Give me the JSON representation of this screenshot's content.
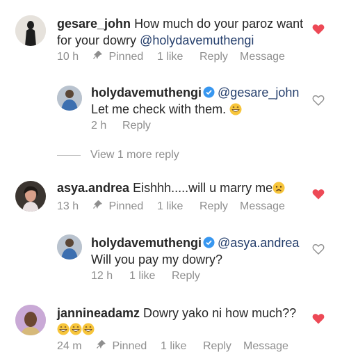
{
  "comments": [
    {
      "username": "gesare_john",
      "text_line1": "How much do your paroz want",
      "text_line2_prefix": "for your dowry",
      "mention": "@holydavemuthengi",
      "time": "10 h",
      "pinned": "Pinned",
      "likes": "1 like",
      "reply": "Reply",
      "message": "Message",
      "liked": true
    },
    {
      "username": "holydavemuthengi",
      "mention": "@gesare_john",
      "text": "Let me check with them.",
      "emoji": "grinning",
      "time": "2 h",
      "reply": "Reply",
      "liked": false
    },
    {
      "username": "asya.andrea",
      "text": "Eishhh.....will u marry me",
      "emoji": "worried",
      "time": "13 h",
      "pinned": "Pinned",
      "likes": "1 like",
      "reply": "Reply",
      "message": "Message",
      "liked": true
    },
    {
      "username": "holydavemuthengi",
      "mention": "@asya.andrea",
      "text": "Will you pay my dowry?",
      "time": "12 h",
      "likes": "1 like",
      "reply": "Reply",
      "liked": false
    },
    {
      "username": "jannineadamz",
      "text": "Dowry yako ni how much??",
      "emoji": "grinning x3",
      "time": "24 m",
      "pinned": "Pinned",
      "likes": "1 like",
      "reply": "Reply",
      "message": "Message",
      "liked": true
    }
  ],
  "view_more": "View 1 more reply",
  "colors": {
    "heart_red": "#ed4956",
    "mention_blue": "#233d6b",
    "meta_gray": "#8e8e8e",
    "verified_blue": "#3897f0"
  }
}
